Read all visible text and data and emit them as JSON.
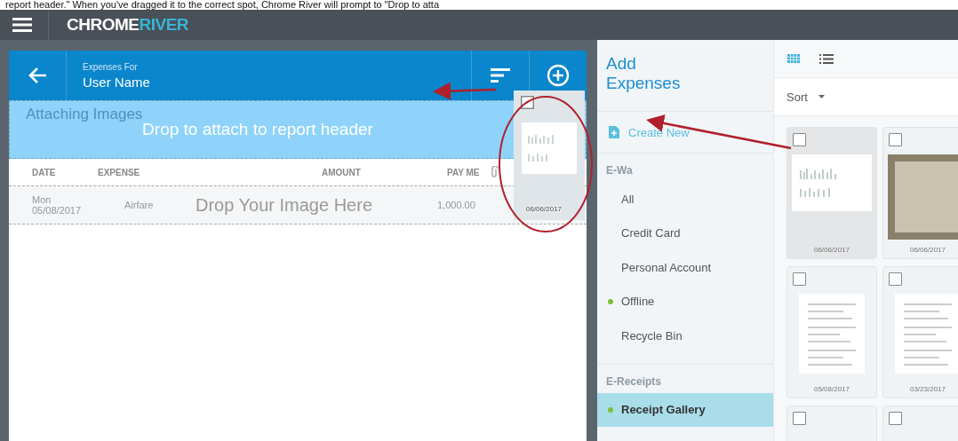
{
  "caption": "report header.\" When you've dragged it to the correct spot, Chrome River will prompt to \"Drop to atta",
  "app_bar": {
    "logo": "CHROME",
    "logo_accent": "RIVER"
  },
  "report": {
    "subtitle": "Expenses For",
    "title": "User Name",
    "section": "Attaching Images",
    "drop_header_text": "Drop to attach to report header",
    "columns": [
      "DATE",
      "EXPENSE",
      "AMOUNT",
      "PAY ME"
    ],
    "row": {
      "day": "Mon",
      "date": "05/08/2017",
      "expense": "Airfare",
      "pay_me": "1,000.00"
    },
    "drop_row_text": "Drop Your Image Here"
  },
  "drag_ghost": {
    "date": "06/06/2017",
    "checked": false
  },
  "sidebar": {
    "title": "Add Expenses",
    "create": "Create New",
    "sections": [
      {
        "label": "E-Wa",
        "items": [
          {
            "label": "All",
            "selected": false,
            "dot": false
          },
          {
            "label": "Credit Card",
            "selected": false,
            "dot": false
          },
          {
            "label": "Personal Account",
            "selected": false,
            "dot": false
          },
          {
            "label": "Offline",
            "selected": false,
            "dot": true
          },
          {
            "label": "Recycle Bin",
            "selected": false,
            "dot": false
          }
        ]
      },
      {
        "label": "E-Receipts",
        "items": [
          {
            "label": "Receipt Gallery",
            "selected": true,
            "dot": true
          }
        ]
      }
    ]
  },
  "gallery": {
    "view_modes": [
      {
        "kind": "grid",
        "selected": true
      },
      {
        "kind": "list",
        "selected": false
      }
    ],
    "sort": "Sort",
    "cards": [
      {
        "kind": "scan",
        "date": "06/06/2017",
        "checked": false,
        "selected": true
      },
      {
        "kind": "photo",
        "date": "06/06/2017",
        "checked": false,
        "selected": false
      },
      {
        "kind": "document",
        "date": "05/08/2017",
        "checked": false,
        "selected": false
      },
      {
        "kind": "document",
        "date": "03/23/2017",
        "checked": false,
        "selected": false
      },
      {
        "kind": "blank",
        "checked": false,
        "selected": false
      },
      {
        "kind": "blank",
        "checked": false,
        "selected": false
      }
    ]
  }
}
